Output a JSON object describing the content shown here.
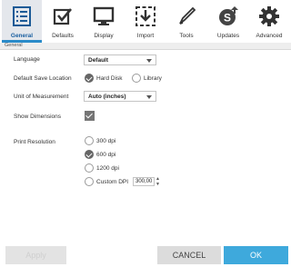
{
  "tabs": [
    {
      "label": "General",
      "icon": "general-list-icon",
      "active": true
    },
    {
      "label": "Defaults",
      "icon": "defaults-checkbox-icon",
      "active": false
    },
    {
      "label": "Display",
      "icon": "monitor-icon",
      "active": false
    },
    {
      "label": "Import",
      "icon": "import-icon",
      "active": false
    },
    {
      "label": "Tools",
      "icon": "pen-tool-icon",
      "active": false
    },
    {
      "label": "Updates",
      "icon": "updates-icon",
      "active": false
    },
    {
      "label": "Advanced",
      "icon": "gear-icon",
      "active": false
    }
  ],
  "section_label": "General",
  "settings": {
    "language": {
      "label": "Language",
      "value": "Default"
    },
    "save_location": {
      "label": "Default Save Location",
      "options": [
        "Hard Disk",
        "Library"
      ],
      "selected": "Hard Disk"
    },
    "unit": {
      "label": "Unit of Measurement",
      "value": "Auto (inches)"
    },
    "dimensions": {
      "label": "Show Dimensions",
      "checked": true
    },
    "print_resolution": {
      "label": "Print Resolution",
      "options": [
        "300 dpi",
        "600 dpi",
        "1200 dpi",
        "Custom DPI"
      ],
      "selected": "600 dpi",
      "custom_value": "300,00"
    }
  },
  "buttons": {
    "apply": "Apply",
    "cancel": "CANCEL",
    "ok": "OK"
  },
  "colors": {
    "accent": "#3ea9dc",
    "active_tab_underline": "#2a8bc9"
  }
}
